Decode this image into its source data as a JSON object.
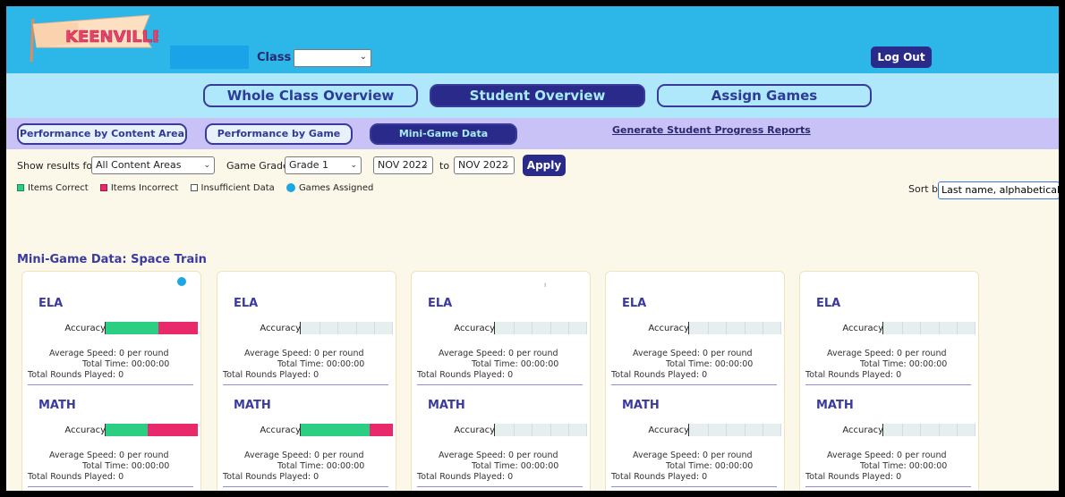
{
  "header": {
    "logo_text": "KEENVILLE",
    "class_label": "Class",
    "class_value": "",
    "logout_label": "Log Out"
  },
  "main_nav": {
    "tabs": [
      {
        "label": "Whole Class Overview",
        "active": false
      },
      {
        "label": "Student Overview",
        "active": true
      },
      {
        "label": "Assign Games",
        "active": false
      }
    ]
  },
  "sub_nav": {
    "tabs": [
      {
        "label": "Performance by Content Area",
        "active": false
      },
      {
        "label": "Performance by Game",
        "active": false
      },
      {
        "label": "Mini-Game Data",
        "active": true
      }
    ],
    "report_link": "Generate Student Progress Reports"
  },
  "filters": {
    "show_results_label": "Show results for:",
    "content_area": "All Content Areas",
    "game_grade_label": "Game Grade:",
    "game_grade": "Grade 1",
    "from_month": "NOV 2022",
    "to_label": "to",
    "to_month": "NOV 2022",
    "apply_label": "Apply"
  },
  "legend": {
    "correct": "Items Correct",
    "incorrect": "Items Incorrect",
    "insufficient": "Insufficient Data",
    "assigned": "Games Assigned"
  },
  "sort": {
    "label": "Sort by:",
    "value": "Last name, alphabetical"
  },
  "section_title": "Mini-Game Data: Space Train",
  "colors": {
    "correct": "#2bce83",
    "incorrect": "#e8296b",
    "assigned": "#1da7e2",
    "accent": "#2a2a8a"
  },
  "stat_labels": {
    "accuracy": "Accuracy",
    "avg_speed": "Average Speed:",
    "total_time": "Total Time:",
    "rounds": "Total Rounds Played:"
  },
  "cards": [
    {
      "assigned": true,
      "ela": {
        "subject": "ELA",
        "correct_frac": 0.57,
        "incorrect_frac": 0.43,
        "avg_speed": "0 per round",
        "total_time": "00:00:00",
        "rounds": "0"
      },
      "math": {
        "subject": "MATH",
        "correct_frac": 0.46,
        "incorrect_frac": 0.54,
        "avg_speed": "0 per round",
        "total_time": "00:00:00",
        "rounds": "0"
      }
    },
    {
      "assigned": false,
      "ela": {
        "subject": "ELA",
        "correct_frac": 0,
        "incorrect_frac": 0,
        "avg_speed": "0 per round",
        "total_time": "00:00:00",
        "rounds": "0"
      },
      "math": {
        "subject": "MATH",
        "correct_frac": 0.75,
        "incorrect_frac": 0.25,
        "avg_speed": "0 per round",
        "total_time": "00:00:00",
        "rounds": "0"
      }
    },
    {
      "assigned": false,
      "ela": {
        "subject": "ELA",
        "correct_frac": 0,
        "incorrect_frac": 0,
        "avg_speed": "0 per round",
        "total_time": "00:00:00",
        "rounds": "0"
      },
      "math": {
        "subject": "MATH",
        "correct_frac": 0,
        "incorrect_frac": 0,
        "avg_speed": "0 per round",
        "total_time": "00:00:00",
        "rounds": "0"
      }
    },
    {
      "assigned": false,
      "ela": {
        "subject": "ELA",
        "correct_frac": 0,
        "incorrect_frac": 0,
        "avg_speed": "0 per round",
        "total_time": "00:00:00",
        "rounds": "0"
      },
      "math": {
        "subject": "MATH",
        "correct_frac": 0,
        "incorrect_frac": 0,
        "avg_speed": "0 per round",
        "total_time": "00:00:00",
        "rounds": "0"
      }
    },
    {
      "assigned": false,
      "ela": {
        "subject": "ELA",
        "correct_frac": 0,
        "incorrect_frac": 0,
        "avg_speed": "0 per round",
        "total_time": "00:00:00",
        "rounds": "0"
      },
      "math": {
        "subject": "MATH",
        "correct_frac": 0,
        "incorrect_frac": 0,
        "avg_speed": "0 per round",
        "total_time": "00:00:00",
        "rounds": "0"
      }
    }
  ]
}
